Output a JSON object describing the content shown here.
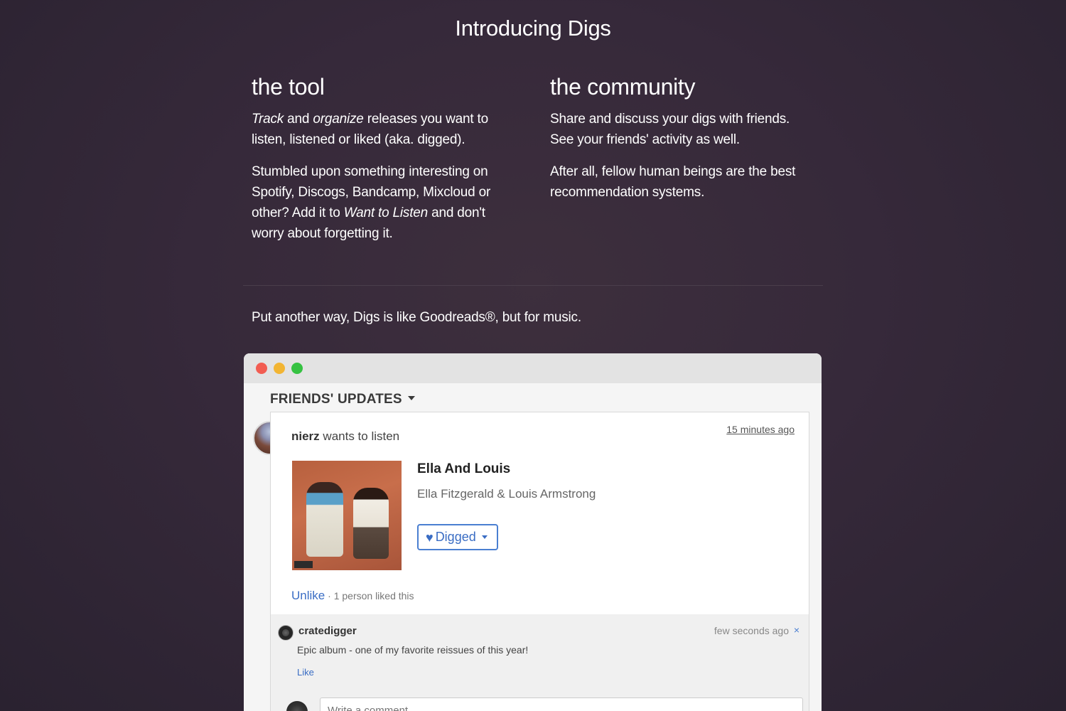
{
  "page": {
    "title": "Introducing Digs"
  },
  "tool": {
    "heading": "the tool",
    "p1_track": "Track",
    "p1_and": " and ",
    "p1_organize": "organize",
    "p1_rest": " releases you want to listen, listened or liked (aka. digged).",
    "p2_start": "Stumbled upon something interesting on Spotify, Discogs, Bandcamp, Mixcloud or other? Add it to ",
    "p2_want": "Want to Listen",
    "p2_end": " and don't worry about forgetting it."
  },
  "community": {
    "heading": "the community",
    "p1": "Share and discuss your digs with friends. See your friends' activity as well.",
    "p2": "After all, fellow human beings are the best recommendation systems."
  },
  "tagline": "Put another way, Digs is like Goodreads®, but for music.",
  "mock": {
    "section_label": "FRIENDS' UPDATES",
    "activity": {
      "user": "nierz",
      "action": " wants to listen",
      "timestamp": "15 minutes ago"
    },
    "release": {
      "title": "Ella And Louis",
      "artist": "Ella Fitzgerald & Louis Armstrong",
      "status_button": "Digged"
    },
    "likes": {
      "unlike_label": "Unlike",
      "summary": " · 1 person liked this"
    },
    "comment": {
      "author": "cratedigger",
      "time": "few seconds ago",
      "close": "×",
      "text": "Epic album - one of my favorite reissues of this year!",
      "like_label": "Like"
    },
    "comment_input": {
      "placeholder": "Write a comment..."
    }
  }
}
